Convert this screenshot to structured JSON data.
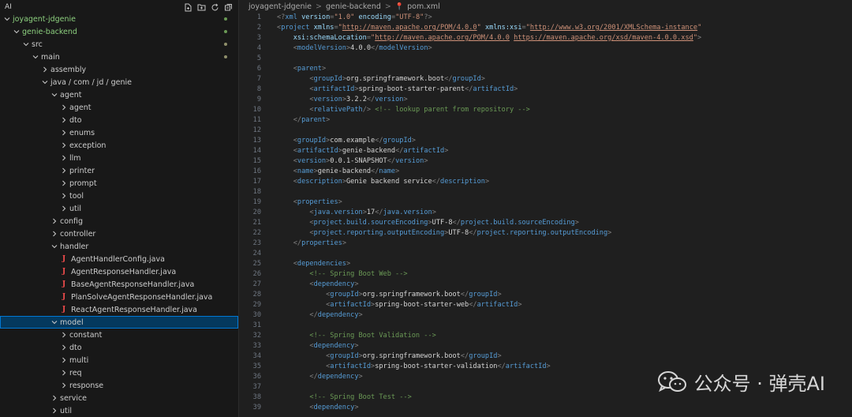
{
  "sidebar": {
    "header_title": "AI",
    "actions": [
      "new-file-icon",
      "new-folder-icon",
      "refresh-icon",
      "collapse-all-icon"
    ],
    "rows": [
      {
        "label": "joyagent-jdgenie",
        "depth": 0,
        "chev": "v",
        "git": true,
        "dot": true
      },
      {
        "label": "genie-backend",
        "depth": 1,
        "chev": "v",
        "git": true,
        "dot": true
      },
      {
        "label": "src",
        "depth": 2,
        "chev": "v",
        "dot": true
      },
      {
        "label": "main",
        "depth": 3,
        "chev": "v",
        "dot": true
      },
      {
        "label": "assembly",
        "depth": 4,
        "chev": ">"
      },
      {
        "label": "java / com / jd / genie",
        "depth": 4,
        "chev": "v"
      },
      {
        "label": "agent",
        "depth": 5,
        "chev": "v"
      },
      {
        "label": "agent",
        "depth": 6,
        "chev": ">"
      },
      {
        "label": "dto",
        "depth": 6,
        "chev": ">"
      },
      {
        "label": "enums",
        "depth": 6,
        "chev": ">"
      },
      {
        "label": "exception",
        "depth": 6,
        "chev": ">"
      },
      {
        "label": "llm",
        "depth": 6,
        "chev": ">"
      },
      {
        "label": "printer",
        "depth": 6,
        "chev": ">"
      },
      {
        "label": "prompt",
        "depth": 6,
        "chev": ">"
      },
      {
        "label": "tool",
        "depth": 6,
        "chev": ">"
      },
      {
        "label": "util",
        "depth": 6,
        "chev": ">"
      },
      {
        "label": "config",
        "depth": 5,
        "chev": ">"
      },
      {
        "label": "controller",
        "depth": 5,
        "chev": ">"
      },
      {
        "label": "handler",
        "depth": 5,
        "chev": "v"
      },
      {
        "label": "AgentHandlerConfig.java",
        "depth": 6,
        "java": true
      },
      {
        "label": "AgentResponseHandler.java",
        "depth": 6,
        "java": true
      },
      {
        "label": "BaseAgentResponseHandler.java",
        "depth": 6,
        "java": true
      },
      {
        "label": "PlanSolveAgentResponseHandler.java",
        "depth": 6,
        "java": true
      },
      {
        "label": "ReactAgentResponseHandler.java",
        "depth": 6,
        "java": true
      },
      {
        "label": "model",
        "depth": 5,
        "chev": "v",
        "selected": true
      },
      {
        "label": "constant",
        "depth": 6,
        "chev": ">"
      },
      {
        "label": "dto",
        "depth": 6,
        "chev": ">"
      },
      {
        "label": "multi",
        "depth": 6,
        "chev": ">"
      },
      {
        "label": "req",
        "depth": 6,
        "chev": ">"
      },
      {
        "label": "response",
        "depth": 6,
        "chev": ">"
      },
      {
        "label": "service",
        "depth": 5,
        "chev": ">"
      },
      {
        "label": "util",
        "depth": 5,
        "chev": ">"
      }
    ]
  },
  "breadcrumb": {
    "items": [
      "joyagent-jdgenie",
      "genie-backend",
      "pom.xml"
    ],
    "separator": ">"
  },
  "editor": {
    "lines": [
      [
        [
          "pi",
          "<?"
        ],
        [
          "tag",
          "xml "
        ],
        [
          "attr",
          "version"
        ],
        [
          "pun",
          "="
        ],
        [
          "val",
          "\"1.0\""
        ],
        [
          "txt",
          " "
        ],
        [
          "attr",
          "encoding"
        ],
        [
          "pun",
          "="
        ],
        [
          "val",
          "\"UTF-8\""
        ],
        [
          "pi",
          "?>"
        ]
      ],
      [
        [
          "pun",
          "<"
        ],
        [
          "tag",
          "project "
        ],
        [
          "attr",
          "xmlns"
        ],
        [
          "pun",
          "="
        ],
        [
          "val",
          "\""
        ],
        [
          "url",
          "http://maven.apache.org/POM/4.0.0"
        ],
        [
          "val",
          "\""
        ],
        [
          "txt",
          " "
        ],
        [
          "attr",
          "xmlns:xsi"
        ],
        [
          "pun",
          "="
        ],
        [
          "val",
          "\""
        ],
        [
          "url",
          "http://www.w3.org/2001/XMLSchema-instance"
        ],
        [
          "val",
          "\""
        ]
      ],
      [
        [
          "txt",
          "    "
        ],
        [
          "attr",
          "xsi:schemaLocation"
        ],
        [
          "pun",
          "="
        ],
        [
          "val",
          "\""
        ],
        [
          "url",
          "http://maven.apache.org/POM/4.0.0"
        ],
        [
          "val",
          " "
        ],
        [
          "url",
          "https://maven.apache.org/xsd/maven-4.0.0.xsd"
        ],
        [
          "val",
          "\""
        ],
        [
          "pun",
          ">"
        ]
      ],
      [
        [
          "txt",
          "    "
        ],
        [
          "pun",
          "<"
        ],
        [
          "tag",
          "modelVersion"
        ],
        [
          "pun",
          ">"
        ],
        [
          "txt",
          "4.0.0"
        ],
        [
          "pun",
          "</"
        ],
        [
          "tag",
          "modelVersion"
        ],
        [
          "pun",
          ">"
        ]
      ],
      [],
      [
        [
          "txt",
          "    "
        ],
        [
          "pun",
          "<"
        ],
        [
          "tag",
          "parent"
        ],
        [
          "pun",
          ">"
        ]
      ],
      [
        [
          "txt",
          "        "
        ],
        [
          "pun",
          "<"
        ],
        [
          "tag",
          "groupId"
        ],
        [
          "pun",
          ">"
        ],
        [
          "txt",
          "org.springframework.boot"
        ],
        [
          "pun",
          "</"
        ],
        [
          "tag",
          "groupId"
        ],
        [
          "pun",
          ">"
        ]
      ],
      [
        [
          "txt",
          "        "
        ],
        [
          "pun",
          "<"
        ],
        [
          "tag",
          "artifactId"
        ],
        [
          "pun",
          ">"
        ],
        [
          "txt",
          "spring-boot-starter-parent"
        ],
        [
          "pun",
          "</"
        ],
        [
          "tag",
          "artifactId"
        ],
        [
          "pun",
          ">"
        ]
      ],
      [
        [
          "txt",
          "        "
        ],
        [
          "pun",
          "<"
        ],
        [
          "tag",
          "version"
        ],
        [
          "pun",
          ">"
        ],
        [
          "txt",
          "3.2.2"
        ],
        [
          "pun",
          "</"
        ],
        [
          "tag",
          "version"
        ],
        [
          "pun",
          ">"
        ]
      ],
      [
        [
          "txt",
          "        "
        ],
        [
          "pun",
          "<"
        ],
        [
          "tag",
          "relativePath"
        ],
        [
          "pun",
          "/> "
        ],
        [
          "com",
          "<!-- lookup parent from repository -->"
        ]
      ],
      [
        [
          "txt",
          "    "
        ],
        [
          "pun",
          "</"
        ],
        [
          "tag",
          "parent"
        ],
        [
          "pun",
          ">"
        ]
      ],
      [],
      [
        [
          "txt",
          "    "
        ],
        [
          "pun",
          "<"
        ],
        [
          "tag",
          "groupId"
        ],
        [
          "pun",
          ">"
        ],
        [
          "txt",
          "com.example"
        ],
        [
          "pun",
          "</"
        ],
        [
          "tag",
          "groupId"
        ],
        [
          "pun",
          ">"
        ]
      ],
      [
        [
          "txt",
          "    "
        ],
        [
          "pun",
          "<"
        ],
        [
          "tag",
          "artifactId"
        ],
        [
          "pun",
          ">"
        ],
        [
          "txt",
          "genie-backend"
        ],
        [
          "pun",
          "</"
        ],
        [
          "tag",
          "artifactId"
        ],
        [
          "pun",
          ">"
        ]
      ],
      [
        [
          "txt",
          "    "
        ],
        [
          "pun",
          "<"
        ],
        [
          "tag",
          "version"
        ],
        [
          "pun",
          ">"
        ],
        [
          "txt",
          "0.0.1-SNAPSHOT"
        ],
        [
          "pun",
          "</"
        ],
        [
          "tag",
          "version"
        ],
        [
          "pun",
          ">"
        ]
      ],
      [
        [
          "txt",
          "    "
        ],
        [
          "pun",
          "<"
        ],
        [
          "tag",
          "name"
        ],
        [
          "pun",
          ">"
        ],
        [
          "txt",
          "genie-backend"
        ],
        [
          "pun",
          "</"
        ],
        [
          "tag",
          "name"
        ],
        [
          "pun",
          ">"
        ]
      ],
      [
        [
          "txt",
          "    "
        ],
        [
          "pun",
          "<"
        ],
        [
          "tag",
          "description"
        ],
        [
          "pun",
          ">"
        ],
        [
          "txt",
          "Genie backend service"
        ],
        [
          "pun",
          "</"
        ],
        [
          "tag",
          "description"
        ],
        [
          "pun",
          ">"
        ]
      ],
      [],
      [
        [
          "txt",
          "    "
        ],
        [
          "pun",
          "<"
        ],
        [
          "tag",
          "properties"
        ],
        [
          "pun",
          ">"
        ]
      ],
      [
        [
          "txt",
          "        "
        ],
        [
          "pun",
          "<"
        ],
        [
          "tag",
          "java.version"
        ],
        [
          "pun",
          ">"
        ],
        [
          "txt",
          "17"
        ],
        [
          "pun",
          "</"
        ],
        [
          "tag",
          "java.version"
        ],
        [
          "pun",
          ">"
        ]
      ],
      [
        [
          "txt",
          "        "
        ],
        [
          "pun",
          "<"
        ],
        [
          "tag",
          "project.build.sourceEncoding"
        ],
        [
          "pun",
          ">"
        ],
        [
          "txt",
          "UTF-8"
        ],
        [
          "pun",
          "</"
        ],
        [
          "tag",
          "project.build.sourceEncoding"
        ],
        [
          "pun",
          ">"
        ]
      ],
      [
        [
          "txt",
          "        "
        ],
        [
          "pun",
          "<"
        ],
        [
          "tag",
          "project.reporting.outputEncoding"
        ],
        [
          "pun",
          ">"
        ],
        [
          "txt",
          "UTF-8"
        ],
        [
          "pun",
          "</"
        ],
        [
          "tag",
          "project.reporting.outputEncoding"
        ],
        [
          "pun",
          ">"
        ]
      ],
      [
        [
          "txt",
          "    "
        ],
        [
          "pun",
          "</"
        ],
        [
          "tag",
          "properties"
        ],
        [
          "pun",
          ">"
        ]
      ],
      [],
      [
        [
          "txt",
          "    "
        ],
        [
          "pun",
          "<"
        ],
        [
          "tag",
          "dependencies"
        ],
        [
          "pun",
          ">"
        ]
      ],
      [
        [
          "txt",
          "        "
        ],
        [
          "com",
          "<!-- Spring Boot Web -->"
        ]
      ],
      [
        [
          "txt",
          "        "
        ],
        [
          "pun",
          "<"
        ],
        [
          "tag",
          "dependency"
        ],
        [
          "pun",
          ">"
        ]
      ],
      [
        [
          "txt",
          "            "
        ],
        [
          "pun",
          "<"
        ],
        [
          "tag",
          "groupId"
        ],
        [
          "pun",
          ">"
        ],
        [
          "txt",
          "org.springframework.boot"
        ],
        [
          "pun",
          "</"
        ],
        [
          "tag",
          "groupId"
        ],
        [
          "pun",
          ">"
        ]
      ],
      [
        [
          "txt",
          "            "
        ],
        [
          "pun",
          "<"
        ],
        [
          "tag",
          "artifactId"
        ],
        [
          "pun",
          ">"
        ],
        [
          "txt",
          "spring-boot-starter-web"
        ],
        [
          "pun",
          "</"
        ],
        [
          "tag",
          "artifactId"
        ],
        [
          "pun",
          ">"
        ]
      ],
      [
        [
          "txt",
          "        "
        ],
        [
          "pun",
          "</"
        ],
        [
          "tag",
          "dependency"
        ],
        [
          "pun",
          ">"
        ]
      ],
      [],
      [
        [
          "txt",
          "        "
        ],
        [
          "com",
          "<!-- Spring Boot Validation -->"
        ]
      ],
      [
        [
          "txt",
          "        "
        ],
        [
          "pun",
          "<"
        ],
        [
          "tag",
          "dependency"
        ],
        [
          "pun",
          ">"
        ]
      ],
      [
        [
          "txt",
          "            "
        ],
        [
          "pun",
          "<"
        ],
        [
          "tag",
          "groupId"
        ],
        [
          "pun",
          ">"
        ],
        [
          "txt",
          "org.springframework.boot"
        ],
        [
          "pun",
          "</"
        ],
        [
          "tag",
          "groupId"
        ],
        [
          "pun",
          ">"
        ]
      ],
      [
        [
          "txt",
          "            "
        ],
        [
          "pun",
          "<"
        ],
        [
          "tag",
          "artifactId"
        ],
        [
          "pun",
          ">"
        ],
        [
          "txt",
          "spring-boot-starter-validation"
        ],
        [
          "pun",
          "</"
        ],
        [
          "tag",
          "artifactId"
        ],
        [
          "pun",
          ">"
        ]
      ],
      [
        [
          "txt",
          "        "
        ],
        [
          "pun",
          "</"
        ],
        [
          "tag",
          "dependency"
        ],
        [
          "pun",
          ">"
        ]
      ],
      [],
      [
        [
          "txt",
          "        "
        ],
        [
          "com",
          "<!-- Spring Boot Test -->"
        ]
      ],
      [
        [
          "txt",
          "        "
        ],
        [
          "pun",
          "<"
        ],
        [
          "tag",
          "dependency"
        ],
        [
          "pun",
          ">"
        ]
      ]
    ]
  },
  "watermark": {
    "text": "公众号 · 弹壳AI",
    "icon": "wechat-icon"
  },
  "colors": {
    "sidebar_bg": "#181818",
    "editor_bg": "#1f1f1f",
    "selection": "#04395e",
    "focus_border": "#0078d4",
    "git_modified": "#8ccf7e",
    "java_icon": "#f14c4c"
  }
}
